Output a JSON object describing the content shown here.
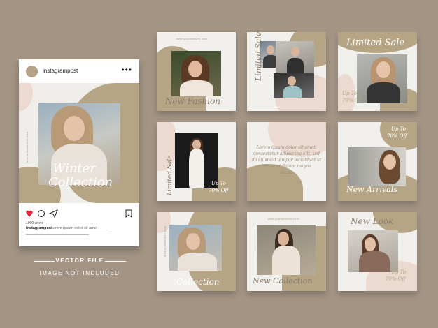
{
  "phone": {
    "username": "instagrampost",
    "views": "1000 views",
    "caption_user": "instagrampost",
    "caption_text": "Lorem ipsum dolor sit amet",
    "post_title_1": "Winter",
    "post_title_2": "Collection",
    "website": "www.yourwebsite.com"
  },
  "tiles": {
    "t1": {
      "title": "New Fashion",
      "url": "www.yourwebsite.com"
    },
    "t2": {
      "title": "Limited Sale"
    },
    "t3": {
      "side_text": "Limited Sale",
      "offer_1": "Up To",
      "offer_2": "70% Off"
    },
    "t4": {
      "body": [
        "Lorem ipsum dolor sit amet,",
        "consectetur adipiscing elit, sed",
        "do eiusmod tempor incididunt ut",
        "labore et dolore magna",
        "aliqua."
      ]
    },
    "t5": {
      "offer_1": "Up To",
      "offer_2": "70% Off",
      "title": "New Arrivals"
    },
    "t6": {
      "title": "Collection",
      "url": "www.yourwebsite.com"
    },
    "t7": {
      "title": "New Collection",
      "url": "www.yourwebsite.com"
    },
    "t8": {
      "title": "New Look",
      "offer_1": "Up To",
      "offer_2": "70% Off"
    },
    "t9": {
      "side_text": "Limited Sale",
      "url": "www.yourwebsite.com"
    }
  },
  "footer": {
    "line1": "VECTOR FILE",
    "line2": "IMAGE NOT INCLUDED"
  },
  "colors": {
    "background": "#a39484",
    "accent_tan": "#b6a585",
    "accent_pink": "#ecd9d0",
    "tile_bg": "#f1f0ec"
  }
}
